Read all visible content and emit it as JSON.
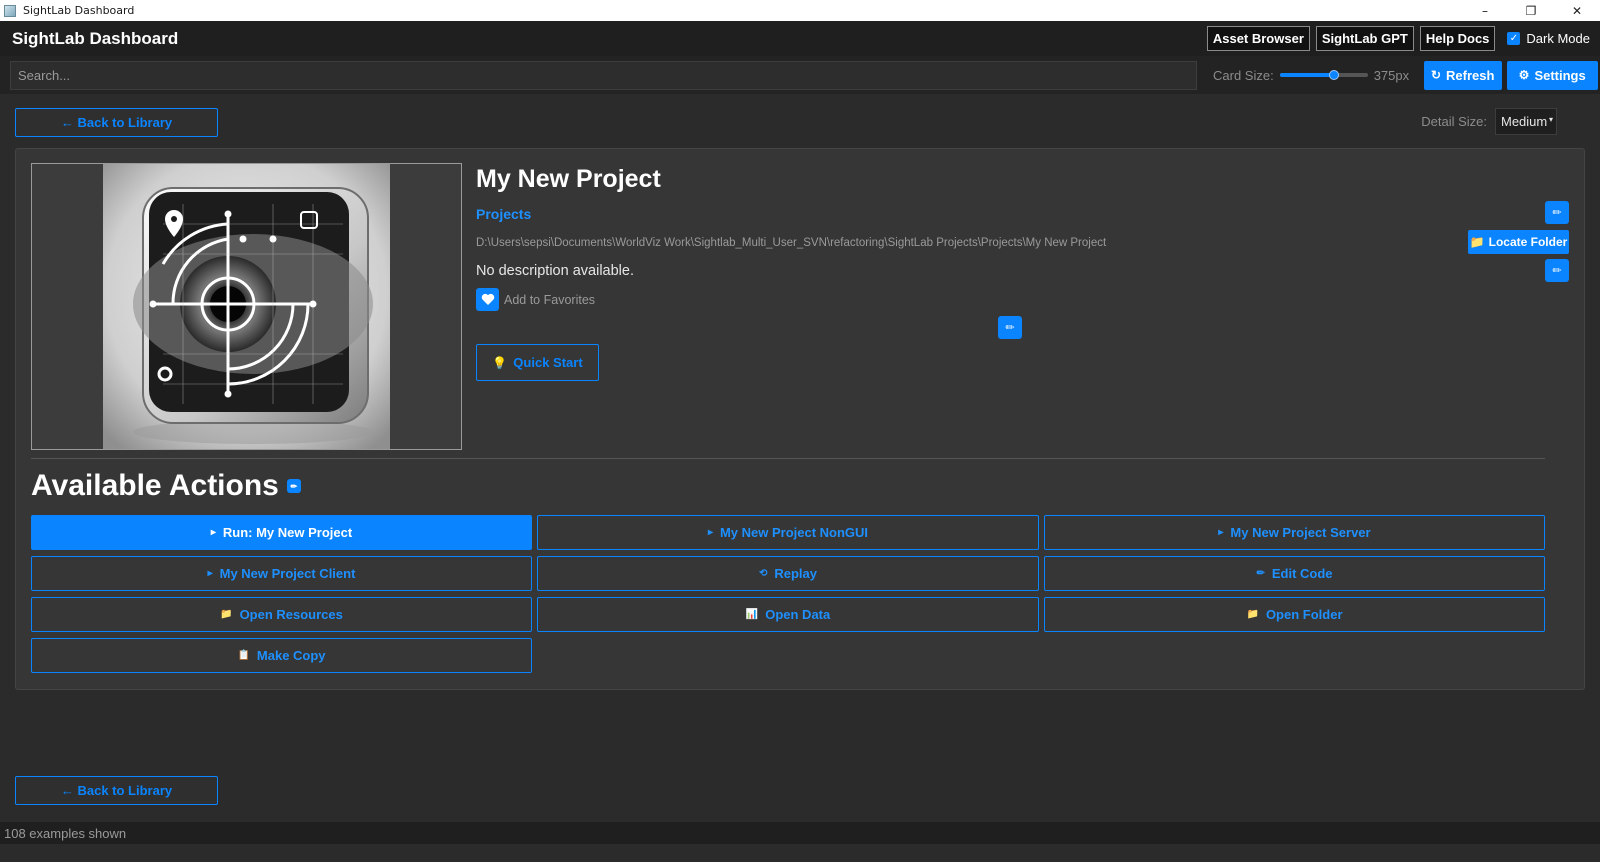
{
  "window": {
    "title": "SightLab Dashboard",
    "minimize": "–",
    "restore": "❐",
    "close": "✕"
  },
  "header": {
    "app_name": "SightLab Dashboard",
    "buttons": [
      "Asset Browser",
      "SightLab GPT",
      "Help Docs"
    ],
    "dark_mode_label": "Dark Mode",
    "dark_mode_checked": true
  },
  "toolbar": {
    "search_placeholder": "Search...",
    "card_size_label": "Card Size:",
    "card_size_value": "375px",
    "card_size_fraction": 0.62,
    "refresh_label": "Refresh",
    "settings_label": "Settings"
  },
  "nav": {
    "back_label": "← Back to Library",
    "detail_size_label": "Detail Size:",
    "detail_size_value": "Medium"
  },
  "project": {
    "title": "My New Project",
    "category": "Projects",
    "path": "D:\\Users\\sepsi\\Documents\\WorldViz Work\\Sightlab_Multi_User_SVN\\refactoring\\SightLab Projects\\Projects\\My New Project",
    "description": "No description available.",
    "favorite_label": "Add to Favorites",
    "locate_folder_label": "Locate Folder",
    "quick_start_label": "Quick Start"
  },
  "actions": {
    "title": "Available Actions",
    "items": [
      {
        "label": "Run: My New Project",
        "icon": "play-icon",
        "glyph": "▸",
        "primary": true
      },
      {
        "label": "My New Project NonGUI",
        "icon": "play-icon",
        "glyph": "▸",
        "primary": false
      },
      {
        "label": "My New Project Server",
        "icon": "play-icon",
        "glyph": "▸",
        "primary": false
      },
      {
        "label": "My New Project Client",
        "icon": "play-icon",
        "glyph": "▸",
        "primary": false
      },
      {
        "label": "Replay",
        "icon": "replay-icon",
        "glyph": "⟲",
        "primary": false
      },
      {
        "label": "Edit Code",
        "icon": "pencil-icon",
        "glyph": "✏",
        "primary": false
      },
      {
        "label": "Open Resources",
        "icon": "folder-icon",
        "glyph": "📁",
        "primary": false
      },
      {
        "label": "Open Data",
        "icon": "chart-icon",
        "glyph": "📊",
        "primary": false
      },
      {
        "label": "Open Folder",
        "icon": "folder-icon",
        "glyph": "📁",
        "primary": false
      },
      {
        "label": "Make Copy",
        "icon": "clipboard-icon",
        "glyph": "📋",
        "primary": false
      }
    ]
  },
  "status": {
    "text": "108 examples shown"
  },
  "colors": {
    "accent": "#0a84ff",
    "background": "#2b2b2b",
    "panel": "#363636"
  }
}
